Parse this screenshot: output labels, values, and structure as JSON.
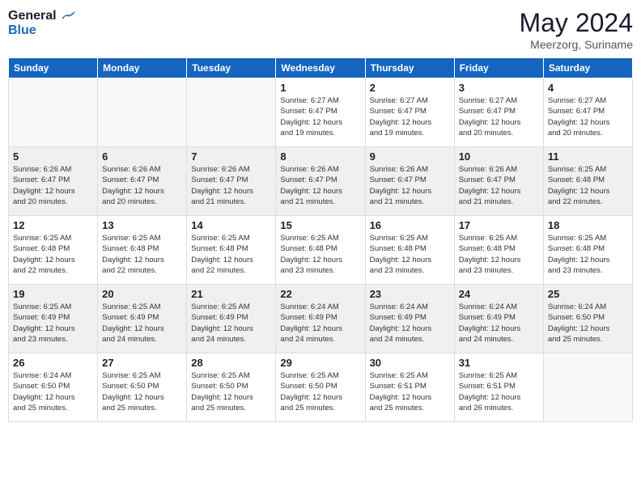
{
  "header": {
    "logo_general": "General",
    "logo_blue": "Blue",
    "month_year": "May 2024",
    "location": "Meerzorg, Suriname"
  },
  "days_of_week": [
    "Sunday",
    "Monday",
    "Tuesday",
    "Wednesday",
    "Thursday",
    "Friday",
    "Saturday"
  ],
  "weeks": [
    [
      {
        "day": "",
        "info": "",
        "empty": true
      },
      {
        "day": "",
        "info": "",
        "empty": true
      },
      {
        "day": "",
        "info": "",
        "empty": true
      },
      {
        "day": "1",
        "info": "Sunrise: 6:27 AM\nSunset: 6:47 PM\nDaylight: 12 hours\nand 19 minutes.",
        "empty": false
      },
      {
        "day": "2",
        "info": "Sunrise: 6:27 AM\nSunset: 6:47 PM\nDaylight: 12 hours\nand 19 minutes.",
        "empty": false
      },
      {
        "day": "3",
        "info": "Sunrise: 6:27 AM\nSunset: 6:47 PM\nDaylight: 12 hours\nand 20 minutes.",
        "empty": false
      },
      {
        "day": "4",
        "info": "Sunrise: 6:27 AM\nSunset: 6:47 PM\nDaylight: 12 hours\nand 20 minutes.",
        "empty": false
      }
    ],
    [
      {
        "day": "5",
        "info": "Sunrise: 6:26 AM\nSunset: 6:47 PM\nDaylight: 12 hours\nand 20 minutes.",
        "empty": false
      },
      {
        "day": "6",
        "info": "Sunrise: 6:26 AM\nSunset: 6:47 PM\nDaylight: 12 hours\nand 20 minutes.",
        "empty": false
      },
      {
        "day": "7",
        "info": "Sunrise: 6:26 AM\nSunset: 6:47 PM\nDaylight: 12 hours\nand 21 minutes.",
        "empty": false
      },
      {
        "day": "8",
        "info": "Sunrise: 6:26 AM\nSunset: 6:47 PM\nDaylight: 12 hours\nand 21 minutes.",
        "empty": false
      },
      {
        "day": "9",
        "info": "Sunrise: 6:26 AM\nSunset: 6:47 PM\nDaylight: 12 hours\nand 21 minutes.",
        "empty": false
      },
      {
        "day": "10",
        "info": "Sunrise: 6:26 AM\nSunset: 6:47 PM\nDaylight: 12 hours\nand 21 minutes.",
        "empty": false
      },
      {
        "day": "11",
        "info": "Sunrise: 6:25 AM\nSunset: 6:48 PM\nDaylight: 12 hours\nand 22 minutes.",
        "empty": false
      }
    ],
    [
      {
        "day": "12",
        "info": "Sunrise: 6:25 AM\nSunset: 6:48 PM\nDaylight: 12 hours\nand 22 minutes.",
        "empty": false
      },
      {
        "day": "13",
        "info": "Sunrise: 6:25 AM\nSunset: 6:48 PM\nDaylight: 12 hours\nand 22 minutes.",
        "empty": false
      },
      {
        "day": "14",
        "info": "Sunrise: 6:25 AM\nSunset: 6:48 PM\nDaylight: 12 hours\nand 22 minutes.",
        "empty": false
      },
      {
        "day": "15",
        "info": "Sunrise: 6:25 AM\nSunset: 6:48 PM\nDaylight: 12 hours\nand 23 minutes.",
        "empty": false
      },
      {
        "day": "16",
        "info": "Sunrise: 6:25 AM\nSunset: 6:48 PM\nDaylight: 12 hours\nand 23 minutes.",
        "empty": false
      },
      {
        "day": "17",
        "info": "Sunrise: 6:25 AM\nSunset: 6:48 PM\nDaylight: 12 hours\nand 23 minutes.",
        "empty": false
      },
      {
        "day": "18",
        "info": "Sunrise: 6:25 AM\nSunset: 6:48 PM\nDaylight: 12 hours\nand 23 minutes.",
        "empty": false
      }
    ],
    [
      {
        "day": "19",
        "info": "Sunrise: 6:25 AM\nSunset: 6:49 PM\nDaylight: 12 hours\nand 23 minutes.",
        "empty": false
      },
      {
        "day": "20",
        "info": "Sunrise: 6:25 AM\nSunset: 6:49 PM\nDaylight: 12 hours\nand 24 minutes.",
        "empty": false
      },
      {
        "day": "21",
        "info": "Sunrise: 6:25 AM\nSunset: 6:49 PM\nDaylight: 12 hours\nand 24 minutes.",
        "empty": false
      },
      {
        "day": "22",
        "info": "Sunrise: 6:24 AM\nSunset: 6:49 PM\nDaylight: 12 hours\nand 24 minutes.",
        "empty": false
      },
      {
        "day": "23",
        "info": "Sunrise: 6:24 AM\nSunset: 6:49 PM\nDaylight: 12 hours\nand 24 minutes.",
        "empty": false
      },
      {
        "day": "24",
        "info": "Sunrise: 6:24 AM\nSunset: 6:49 PM\nDaylight: 12 hours\nand 24 minutes.",
        "empty": false
      },
      {
        "day": "25",
        "info": "Sunrise: 6:24 AM\nSunset: 6:50 PM\nDaylight: 12 hours\nand 25 minutes.",
        "empty": false
      }
    ],
    [
      {
        "day": "26",
        "info": "Sunrise: 6:24 AM\nSunset: 6:50 PM\nDaylight: 12 hours\nand 25 minutes.",
        "empty": false
      },
      {
        "day": "27",
        "info": "Sunrise: 6:25 AM\nSunset: 6:50 PM\nDaylight: 12 hours\nand 25 minutes.",
        "empty": false
      },
      {
        "day": "28",
        "info": "Sunrise: 6:25 AM\nSunset: 6:50 PM\nDaylight: 12 hours\nand 25 minutes.",
        "empty": false
      },
      {
        "day": "29",
        "info": "Sunrise: 6:25 AM\nSunset: 6:50 PM\nDaylight: 12 hours\nand 25 minutes.",
        "empty": false
      },
      {
        "day": "30",
        "info": "Sunrise: 6:25 AM\nSunset: 6:51 PM\nDaylight: 12 hours\nand 25 minutes.",
        "empty": false
      },
      {
        "day": "31",
        "info": "Sunrise: 6:25 AM\nSunset: 6:51 PM\nDaylight: 12 hours\nand 26 minutes.",
        "empty": false
      },
      {
        "day": "",
        "info": "",
        "empty": true
      }
    ]
  ]
}
